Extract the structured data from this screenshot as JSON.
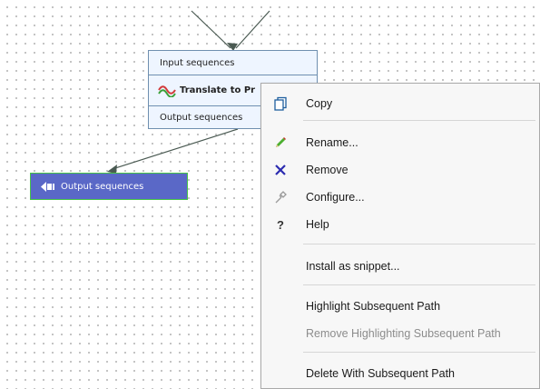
{
  "workflow_element": {
    "input_label": "Input sequences",
    "tool_label": "Translate to Pr",
    "output_label": "Output sequences"
  },
  "output_node": {
    "label": "Output sequences"
  },
  "context_menu": {
    "items": [
      {
        "label": "Copy",
        "icon": "copy-icon",
        "enabled": true
      },
      {
        "label": "Rename...",
        "icon": "pencil-icon",
        "enabled": true
      },
      {
        "label": "Remove",
        "icon": "x-icon",
        "enabled": true
      },
      {
        "label": "Configure...",
        "icon": "configure-icon",
        "enabled": true
      },
      {
        "label": "Help",
        "icon": "help-icon",
        "enabled": true
      },
      {
        "label": "Install as snippet...",
        "icon": "",
        "enabled": true
      },
      {
        "label": "Highlight Subsequent Path",
        "icon": "",
        "enabled": true
      },
      {
        "label": "Remove Highlighting Subsequent Path",
        "icon": "",
        "enabled": false
      },
      {
        "label": "Delete With Subsequent Path",
        "icon": "",
        "enabled": true
      }
    ]
  },
  "colors": {
    "canvas": "#ffffff",
    "grid_dot": "#b4b4b4",
    "element_fill": "#eef5ff",
    "element_border": "#6f8fb0",
    "output_fill": "#5a68c7",
    "output_border": "#47c447",
    "connector": "#4a5a52",
    "menu_bg": "#f7f7f7",
    "remove_icon": "#2b2bb0",
    "disabled_text": "#8c8c8c"
  }
}
